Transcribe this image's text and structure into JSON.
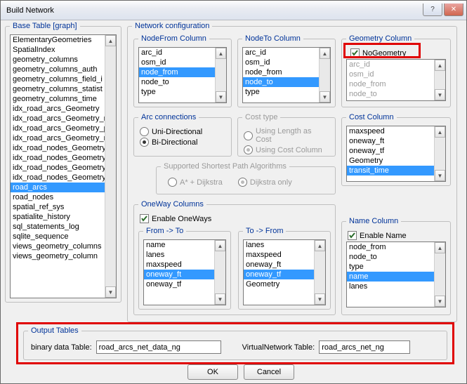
{
  "window": {
    "title": "Build Network"
  },
  "baseTable": {
    "legend": "Base Table [graph]",
    "items": [
      "ElementaryGeometries",
      "SpatialIndex",
      "geometry_columns",
      "geometry_columns_auth",
      "geometry_columns_field_i",
      "geometry_columns_statist",
      "geometry_columns_time",
      "idx_road_arcs_Geometry",
      "idx_road_arcs_Geometry_n",
      "idx_road_arcs_Geometry_p",
      "idx_road_arcs_Geometry_r",
      "idx_road_nodes_Geometry",
      "idx_road_nodes_Geometry",
      "idx_road_nodes_Geometry",
      "idx_road_nodes_Geometry",
      "road_arcs",
      "road_nodes",
      "spatial_ref_sys",
      "spatialite_history",
      "sql_statements_log",
      "sqlite_sequence",
      "views_geometry_columns",
      "views_geometry_column"
    ],
    "selected": "road_arcs"
  },
  "netcfg": {
    "legend": "Network configuration"
  },
  "nodeFrom": {
    "legend": "NodeFrom Column",
    "items": [
      "arc_id",
      "osm_id",
      "node_from",
      "node_to",
      "type"
    ],
    "selected": "node_from"
  },
  "nodeTo": {
    "legend": "NodeTo Column",
    "items": [
      "arc_id",
      "osm_id",
      "node_from",
      "node_to",
      "type"
    ],
    "selected": "node_to"
  },
  "geomCol": {
    "legend": "Geometry Column",
    "check": "NoGeometry",
    "items": [
      "arc_id",
      "osm_id",
      "node_from",
      "node_to"
    ]
  },
  "arcConn": {
    "legend": "Arc connections",
    "uni": "Uni-Directional",
    "bi": "Bi-Directional"
  },
  "costType": {
    "legend": "Cost type",
    "len": "Using Length as Cost",
    "col": "Using Cost Column"
  },
  "costCol": {
    "legend": "Cost Column",
    "items": [
      "maxspeed",
      "oneway_ft",
      "oneway_tf",
      "Geometry",
      "transit_time"
    ],
    "selected": "transit_time"
  },
  "algo": {
    "legend": "Supported Shortest Path Algorithms",
    "astar": "A* + Dijkstra",
    "dij": "Dijkstra only"
  },
  "oneway": {
    "legend": "OneWay Columns",
    "enable": "Enable OneWays",
    "fromTo": {
      "legend": "From -> To",
      "items": [
        "name",
        "lanes",
        "maxspeed",
        "oneway_ft",
        "oneway_tf"
      ],
      "selected": "oneway_ft"
    },
    "toFrom": {
      "legend": "To -> From",
      "items": [
        "lanes",
        "maxspeed",
        "oneway_ft",
        "oneway_tf",
        "Geometry"
      ],
      "selected": "oneway_tf"
    }
  },
  "nameCol": {
    "legend": "Name Column",
    "enable": "Enable Name",
    "items": [
      "node_from",
      "node_to",
      "type",
      "name",
      "lanes"
    ],
    "selected": "name"
  },
  "output": {
    "legend": "Output Tables",
    "binLabel": "binary data Table:",
    "binVal": "road_arcs_net_data_ng",
    "vnLabel": "VirtualNetwork Table:",
    "vnVal": "road_arcs_net_ng"
  },
  "buttons": {
    "ok": "OK",
    "cancel": "Cancel"
  }
}
